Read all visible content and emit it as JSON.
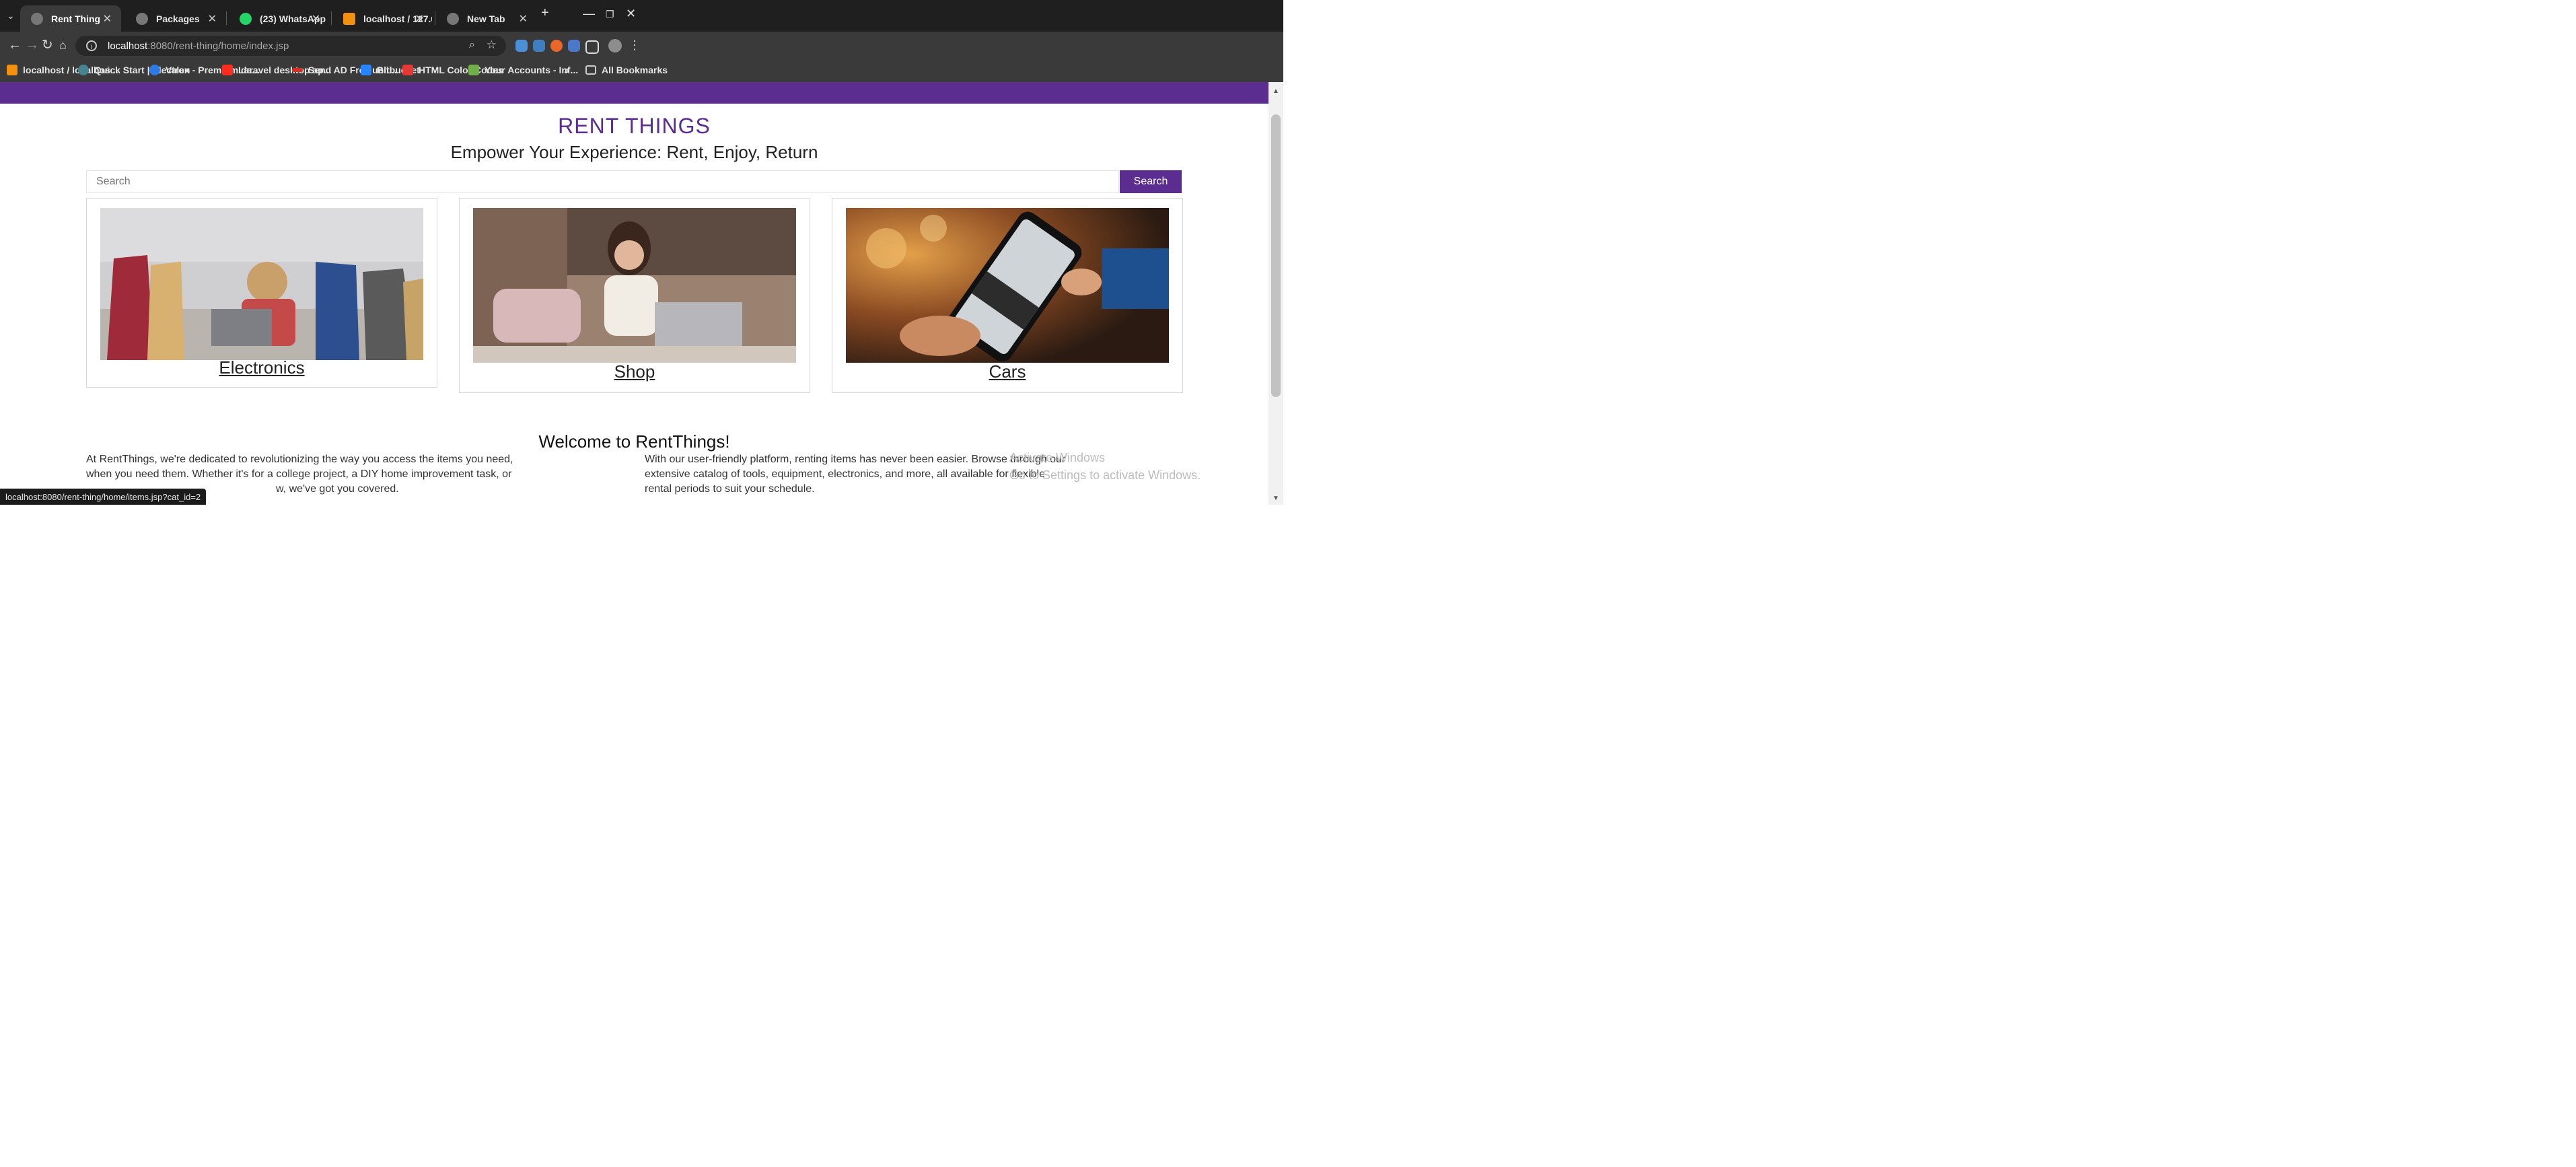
{
  "browser": {
    "tabs": [
      {
        "title": "Rent Thing",
        "active": true
      },
      {
        "title": "Packages",
        "active": false
      },
      {
        "title": "(23) WhatsApp",
        "active": false
      },
      {
        "title": "localhost / 127.0.0.1 / rent",
        "active": false
      },
      {
        "title": "New Tab",
        "active": false
      }
    ],
    "url_host": "localhost",
    "url_rest": ":8080/rent-thing/home/index.jsp",
    "bookmarks": [
      "localhost / localhos...",
      "Quick Start | Electron",
      "Valex - Premium da...",
      "Laravel desktop ap...",
      "Send AD Free unli...",
      "Bitbucket",
      "HTML Color Codes",
      "Your Accounts - Inf..."
    ],
    "bookmarks_overflow": "»",
    "all_bookmarks": "All Bookmarks",
    "status_url": "localhost:8080/rent-thing/home/items.jsp?cat_id=2"
  },
  "site": {
    "title": "RENT THINGS",
    "tagline": "Empower Your Experience: Rent, Enjoy, Return",
    "search_placeholder": "Search",
    "search_button": "Search",
    "categories": [
      {
        "label": "Electronics"
      },
      {
        "label": "Shop"
      },
      {
        "label": "Cars"
      }
    ],
    "welcome_heading": "Welcome to RentThings!",
    "para_left": "At RentThings, we're dedicated to revolutionizing the way you access the items you need, when you need them. Whether it's for a college project, a DIY home improvement task, or ... w, we've got you covered.",
    "para_left_line1": "At RentThings, we're dedicated to revolutionizing the way you access the items you need,",
    "para_left_line2": "when you need them. Whether it's for a college project, a DIY home improvement task, or",
    "para_left_line3": "w, we've got you covered.",
    "para_right_line1": "With our user-friendly platform, renting items has never been easier. Browse through our",
    "para_right_line2": "extensive catalog of tools, equipment, electronics, and more, all available for flexible",
    "para_right_line3": "rental periods to suit your schedule.",
    "watermark_line1": "Activate Windows",
    "watermark_line2": "Go to Settings to activate Windows."
  },
  "colors": {
    "brand": "#5b2d91",
    "tabbar": "#1f1f1f",
    "toolbar": "#3a3a3a"
  }
}
